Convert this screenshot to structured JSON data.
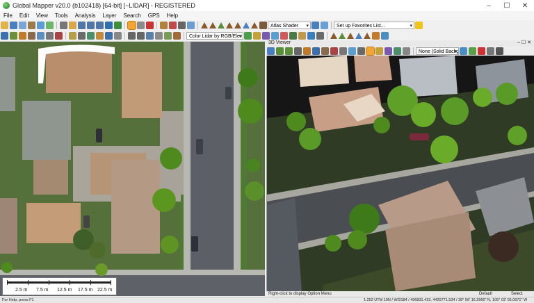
{
  "window": {
    "title": "Global Mapper v20.0 (b102418) [64-bit] [~LIDAR] - REGISTERED",
    "controls": [
      "–",
      "☐",
      "✕"
    ]
  },
  "menu": [
    "File",
    "Edit",
    "View",
    "Tools",
    "Analysis",
    "Layer",
    "Search",
    "GPS",
    "Help"
  ],
  "toolbar": {
    "shader_select": "Atlas Shader",
    "favorites_select": "Set up Favorites List...",
    "lidar_color_select": "Color Lidar by RGB/Elev"
  },
  "map2d": {
    "scale_labels": [
      "2.5 m",
      "7.5 m",
      "12.5 m",
      "17.5 m",
      "22.5 m"
    ]
  },
  "viewer3d": {
    "title": "3D Viewer",
    "background_select": "None (Solid Background)",
    "status_hint": "Right-click to display Option Menu",
    "status_mode": "Default",
    "status_action": "Select"
  },
  "statusbar": {
    "help": "For Help, press F1",
    "coords": "1:252  UTM 10N / WGS84 / 496831.419, 4420771.534 / 38° 56' 16.2966\" N, 105° 02' 05.0971\" W"
  },
  "colors": {
    "grass": "#55703a",
    "tree": "#4f8a1f",
    "road": "#5c5f66",
    "sidewalk": "#b8b8b2",
    "roof_warm": "#b98e6c",
    "roof_gray": "#8f9690",
    "accent_orange": "#f3a533"
  }
}
